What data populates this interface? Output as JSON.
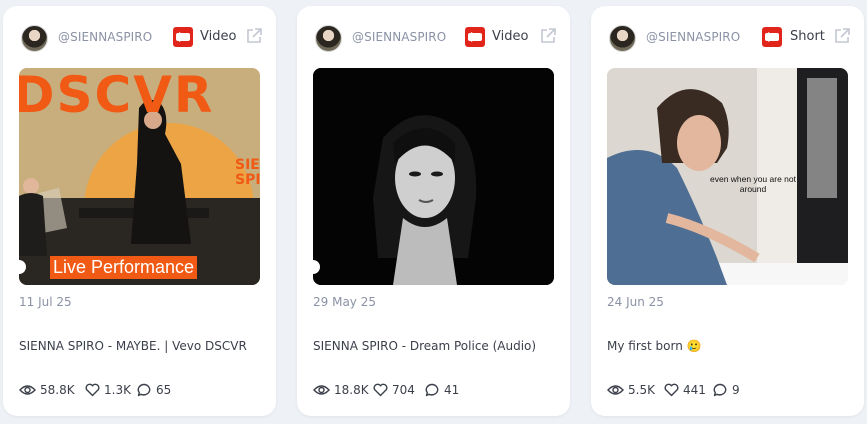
{
  "cards": [
    {
      "handle": "@SIENNASPIRO",
      "type": "Video",
      "thumb_text": "Live Performance",
      "thumb_brand_text": "DSCVR",
      "thumb_side_text": "SIE SPIR",
      "date": "11 Jul 25",
      "title": "SIENNA SPIRO - MAYBE. | Vevo DSCVR",
      "views": "58.8K",
      "likes": "1.3K",
      "comments": "65"
    },
    {
      "handle": "@SIENNASPIRO",
      "type": "Video",
      "date": "29 May 25",
      "title": "SIENNA SPIRO - Dream Police (Audio)",
      "views": "18.8K",
      "likes": "704",
      "comments": "41"
    },
    {
      "handle": "@SIENNASPIRO",
      "type": "Short",
      "thumb_caption": "even when you are not around",
      "date": "24 Jun 25",
      "title": "My first born 🥲",
      "views": "5.5K",
      "likes": "441",
      "comments": "9"
    }
  ],
  "colors": {
    "background": "#eef1f6",
    "youtube_red": "#e1251b",
    "vevo_orange": "#f05a14",
    "muted_text": "#8b92a5",
    "body_text": "#3b3f4a"
  },
  "icons": {
    "platform": "youtube-icon",
    "open": "external-link-icon",
    "views": "eye-icon",
    "likes": "heart-icon",
    "comments": "comment-icon"
  }
}
